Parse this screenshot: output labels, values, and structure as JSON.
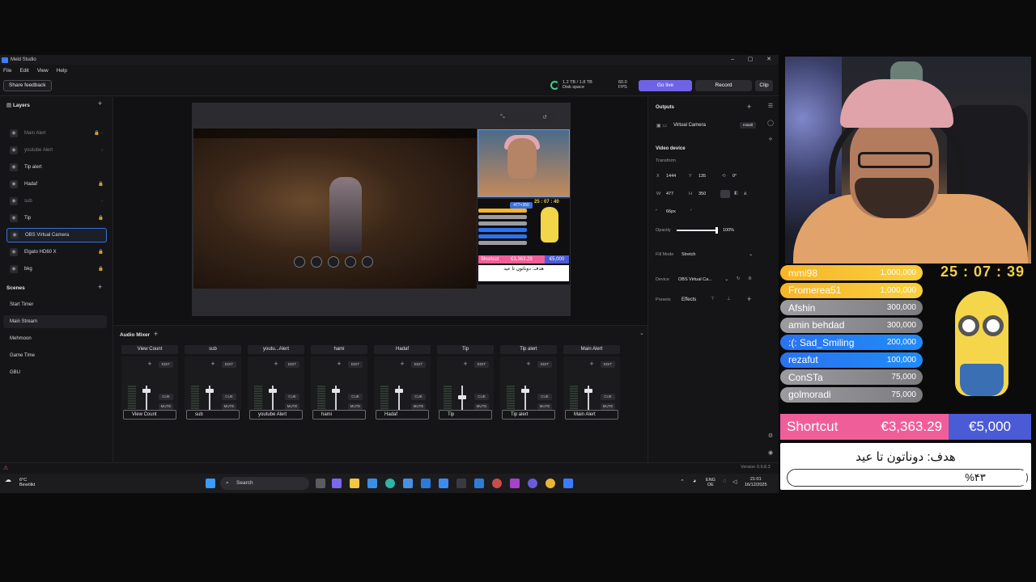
{
  "app": {
    "title": "Meld Studio",
    "minimize_glyph": "–",
    "maximize_glyph": "▢",
    "close_glyph": "✕"
  },
  "menu": [
    "File",
    "Edit",
    "View",
    "Help"
  ],
  "toolbar": {
    "share_feedback": "Share feedback",
    "disk_usage": "1.2 TB / 1.8 TB",
    "disk_label": "Disk space",
    "fps_value": "60.0",
    "fps_label": "FPS",
    "go_live": "Go live",
    "record": "Record",
    "clip": "Clip"
  },
  "layers": {
    "header": "Layers",
    "items": [
      {
        "label": "Main Alert",
        "icon": "alert-icon",
        "dim": true,
        "lock": "🔒 ◌"
      },
      {
        "label": "youtube Alert",
        "icon": "alert-icon",
        "dim": true,
        "lock": "◌"
      },
      {
        "label": "Tip alert",
        "icon": "alert-icon",
        "dim": false,
        "lock": ""
      },
      {
        "label": "Hadaf",
        "icon": "image-icon",
        "dim": false,
        "lock": "🔒"
      },
      {
        "label": "sub",
        "icon": "alert-icon",
        "dim": true,
        "lock": "◌"
      },
      {
        "label": "Tip",
        "icon": "alert-icon",
        "dim": false,
        "lock": "🔒"
      },
      {
        "label": "OBS Virtual Camera",
        "icon": "camera-icon",
        "dim": false,
        "lock": "",
        "selected": true
      },
      {
        "label": "Elgato HD60 X",
        "icon": "capture-icon",
        "dim": false,
        "lock": "🔒"
      },
      {
        "label": "bkg",
        "icon": "image-icon",
        "dim": false,
        "lock": "🔒"
      }
    ]
  },
  "scenes": {
    "header": "Scenes",
    "items": [
      "Start Timer",
      "Main Stream",
      "Mehmoon",
      "Game Time",
      "GBU"
    ],
    "active_index": 1
  },
  "audio_mixer": {
    "title": "Audio Mixer",
    "add_glyph": "+",
    "edit_label": "EDIT",
    "cue_label": "CUE",
    "mute_label": "MUTE",
    "channels": [
      {
        "name": "View Count",
        "footer": "View Count",
        "level": 0.88
      },
      {
        "name": "sub",
        "footer": "sub",
        "level": 0.88
      },
      {
        "name": "youtu...Alert",
        "footer": "youtube Alert",
        "level": 0.88
      },
      {
        "name": "hami",
        "footer": "hami",
        "level": 0.88
      },
      {
        "name": "Hadaf",
        "footer": "Hadaf",
        "level": 0.88
      },
      {
        "name": "Tip",
        "footer": "Tip",
        "level": 0.6
      },
      {
        "name": "Tip alert",
        "footer": "Tip alert",
        "level": 0.88
      },
      {
        "name": "Main Alert",
        "footer": "Main Alert",
        "level": 0.88
      }
    ]
  },
  "properties": {
    "outputs_header": "Outputs",
    "virtual_camera": "Virtual Camera",
    "install": "Install",
    "video_device": "Video device",
    "transform": "Transform",
    "x_label": "X",
    "x_value": "1444",
    "y_label": "Y",
    "y_value": "135",
    "rotation": "0°",
    "w_label": "W",
    "w_value": "477",
    "h_label": "H",
    "h_value": "350",
    "corner_radius": "66px",
    "opacity_label": "Opacity",
    "opacity_value": "100%",
    "opacity_level": 1.0,
    "fill_mode_label": "Fill Mode",
    "fill_mode_value": "Stretch",
    "device_label": "Device",
    "device_value": "OBS Virtual Ca...",
    "tab_presets": "Presets",
    "tab_effects": "Effects",
    "version": "Version 0.9.8.3"
  },
  "preview": {
    "size_badge": "477×350",
    "mini_timer": "25 : 07 : 40",
    "mini_shortcut": "Shortcut",
    "mini_amount": "€3,363.29",
    "mini_goal_total": "€5,000",
    "mini_goal_text": "هدف: دوناتون تا عيد"
  },
  "taskbar": {
    "weather_temp": "6°C",
    "weather_text": "Bewölkt",
    "search": "Search",
    "lang_top": "ENG",
    "lang_bottom": "DE",
    "time": "21:01",
    "date": "16/12/2025"
  },
  "stream_overlay": {
    "timer": "25 : 07 : 39",
    "donors": [
      {
        "name": "mmi98",
        "amount": "1,000,000",
        "style": "gold"
      },
      {
        "name": "Fromerea51",
        "amount": "1,000,000",
        "style": "gold"
      },
      {
        "name": "Afshin",
        "amount": "300,000",
        "style": "silver"
      },
      {
        "name": "amin behdad",
        "amount": "300,000",
        "style": "silver"
      },
      {
        "name": ":(: Sad_Smiling",
        "amount": "200,000",
        "style": "blue"
      },
      {
        "name": "rezafut",
        "amount": "100,000",
        "style": "blue"
      },
      {
        "name": "ConSTa",
        "amount": "75,000",
        "style": "silver"
      },
      {
        "name": "golmoradi",
        "amount": "75,000",
        "style": "silver"
      }
    ],
    "shortcut_label": "Shortcut",
    "current_amount": "€3,363.29",
    "goal_amount": "€5,000",
    "goal_title": "هدف: دوناتون تا عيد",
    "goal_percent": "%۴۳"
  },
  "colors": {
    "accent": "#6e62e5",
    "selection": "#3d6fd6",
    "shortcut_pink": "#f05e9a",
    "goal_blue": "#4b5bd6",
    "timer_yellow": "#f3d04a"
  }
}
